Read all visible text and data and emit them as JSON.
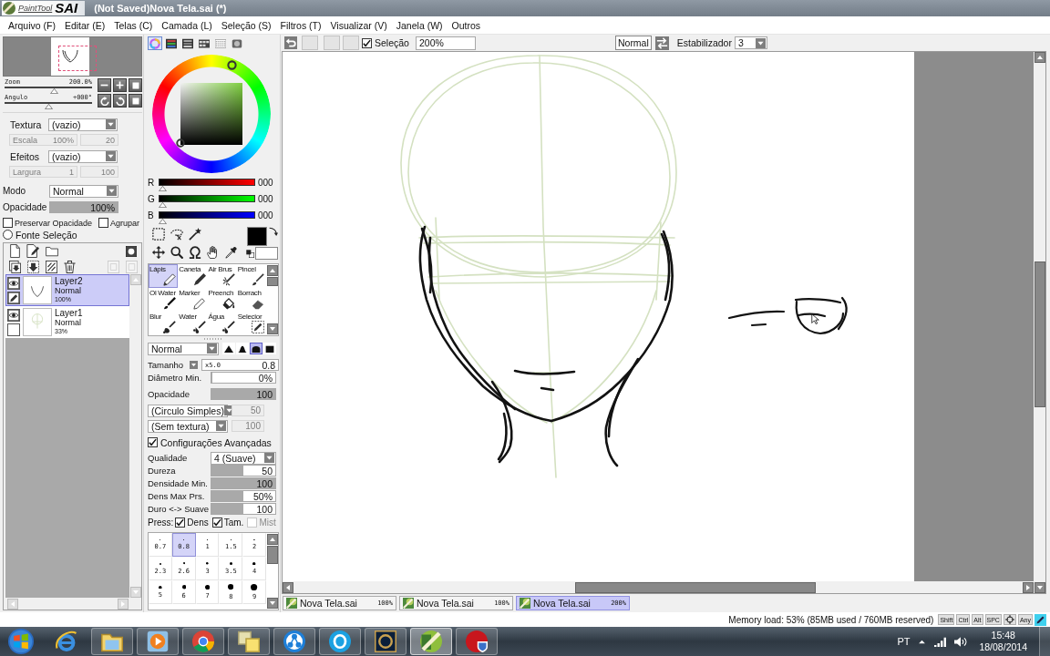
{
  "title_bar": {
    "logo_small": "PaintTool",
    "logo_large": "SAI",
    "title": "(Not Saved)Nova Tela.sai (*)"
  },
  "menu": [
    {
      "label": "Arquivo (F)"
    },
    {
      "label": "Editar (E)"
    },
    {
      "label": "Telas (C)"
    },
    {
      "label": "Camada (L)"
    },
    {
      "label": "Seleção (S)"
    },
    {
      "label": "Filtros (T)"
    },
    {
      "label": "Visualizar (V)"
    },
    {
      "label": "Janela (W)"
    },
    {
      "label": "Outros"
    }
  ],
  "navigator": {
    "zoom": {
      "label": "Zoom",
      "value": "200.0%",
      "level": 0.58
    },
    "angle": {
      "label": "Angulo",
      "value": "+000°",
      "level": 0.5
    }
  },
  "texture": {
    "label": "Textura",
    "value": "(vazio)",
    "sub_label": "Escala",
    "sub_value": "100%",
    "sub_value_2": "20",
    "disabled": true
  },
  "effects": {
    "label": "Efeitos",
    "value": "(vazio)",
    "sub_label": "Largura",
    "sub_value": "1",
    "sub_value_2": "100",
    "disabled": true
  },
  "layer_settings": {
    "mode_label": "Modo",
    "mode": "Normal",
    "opacity": {
      "label": "Opacidade",
      "value": "100%",
      "level": 1
    },
    "options": [
      {
        "label": "Preservar Opacidade",
        "checked": false
      },
      {
        "label": "Agrupar",
        "checked": false
      }
    ],
    "selection_source": {
      "label": "Fonte Seleção",
      "selected": false
    }
  },
  "layers": [
    {
      "name": "Layer2",
      "mode": "Normal",
      "opacity": "100%",
      "kind": "ink",
      "selected": true,
      "visible": true,
      "editing": true
    },
    {
      "name": "Layer1",
      "mode": "Normal",
      "opacity": "33%",
      "kind": "guide",
      "selected": false,
      "visible": true,
      "editing": false
    }
  ],
  "color_panel": {
    "tabs": [
      {
        "kind": "wheel",
        "selected": true
      },
      {
        "kind": "rgb",
        "selected": false
      },
      {
        "kind": "hsv",
        "selected": false
      },
      {
        "kind": "swatches",
        "selected": false
      },
      {
        "kind": "grid",
        "selected": false
      },
      {
        "kind": "scratch",
        "selected": false
      }
    ],
    "channels": [
      {
        "label": "R",
        "value": "000",
        "level": 0,
        "kind": "red"
      },
      {
        "label": "G",
        "value": "000",
        "level": 0,
        "kind": "green"
      },
      {
        "label": "B",
        "value": "000",
        "level": 0,
        "kind": "blue"
      }
    ],
    "colors": [
      {
        "kind": "primary",
        "color": "#000000"
      },
      {
        "kind": "secondary",
        "color": "#ffffff"
      }
    ]
  },
  "selection_tools": [
    {
      "tools": [
        {
          "kind": "marquee",
          "selected": false
        },
        {
          "kind": "lasso",
          "selected": false
        },
        {
          "kind": "wand",
          "selected": false
        }
      ]
    },
    {
      "tools": [
        {
          "kind": "move",
          "selected": false
        },
        {
          "kind": "zoom",
          "selected": false
        },
        {
          "kind": "rotate",
          "selected": false
        },
        {
          "kind": "hand",
          "selected": false
        },
        {
          "kind": "picker",
          "selected": false
        }
      ]
    }
  ],
  "brush_tools": [
    {
      "label": "Lápis",
      "kind": "pencil",
      "selected": true
    },
    {
      "label": "Caneta",
      "kind": "pen",
      "selected": false
    },
    {
      "label": "Air Brus",
      "kind": "airbrush",
      "selected": false
    },
    {
      "label": "Pincel",
      "kind": "brush",
      "selected": false
    },
    {
      "label": "Ol Water",
      "kind": "watercolor",
      "selected": false
    },
    {
      "label": "Marker",
      "kind": "marker",
      "selected": false
    },
    {
      "label": "Preench",
      "kind": "bucket",
      "selected": false
    },
    {
      "label": "Borrach",
      "kind": "eraser",
      "selected": false
    },
    {
      "label": "Blur",
      "kind": "blur",
      "selected": false
    },
    {
      "label": "Water",
      "kind": "water",
      "selected": false
    },
    {
      "label": "Água",
      "kind": "water",
      "selected": false
    },
    {
      "label": "Selecior",
      "kind": "selpen",
      "selected": false
    }
  ],
  "brush_settings": {
    "blend": "Normal",
    "shapes": [
      {
        "kind": "peak",
        "selected": false
      },
      {
        "kind": "bell",
        "selected": false
      },
      {
        "kind": "dome",
        "selected": true
      },
      {
        "kind": "flat",
        "selected": false
      }
    ],
    "size": {
      "label": "Tamanho",
      "multiplier": "x5.0",
      "value": "0.8"
    },
    "min_size": {
      "label": "Diâmetro Min.",
      "value": "0%",
      "level": 0
    },
    "opacity": {
      "label": "Opacidade",
      "value": "100",
      "level": 1
    },
    "shape": {
      "value": "(Circulo Simples)",
      "amount": "50",
      "disabled": true
    },
    "paper": {
      "value": "(Sem textura)",
      "amount": "100",
      "disabled": true
    },
    "advanced": {
      "label": "Configurações Avançadas",
      "checked": true
    },
    "quality": {
      "label": "Qualidade",
      "value": "4 (Suave)"
    },
    "sliders": [
      {
        "label": "Dureza",
        "value": "50",
        "level": 0.5
      },
      {
        "label": "Densidade Min.",
        "value": "100",
        "level": 1
      },
      {
        "label": "Dens Max Prs.",
        "value": "50%",
        "level": 0.5
      },
      {
        "label": "Duro <-> Suave",
        "value": "100",
        "level": 0.5
      }
    ],
    "pressure": {
      "label": "Press:",
      "options": [
        {
          "label": "Dens",
          "checked": true,
          "disabled": false
        },
        {
          "label": "Tam.",
          "checked": true,
          "disabled": false
        },
        {
          "label": "Mist",
          "checked": false,
          "disabled": true
        }
      ]
    },
    "sizes": [
      {
        "label": "0.7",
        "selected": false
      },
      {
        "label": "0.8",
        "selected": true
      },
      {
        "label": "1",
        "selected": false
      },
      {
        "label": "1.5",
        "selected": false
      },
      {
        "label": "2",
        "selected": false
      },
      {
        "label": "2.3",
        "selected": false
      },
      {
        "label": "2.6",
        "selected": false
      },
      {
        "label": "3",
        "selected": false
      },
      {
        "label": "3.5",
        "selected": false
      },
      {
        "label": "4",
        "selected": false
      },
      {
        "label": "5",
        "selected": false
      },
      {
        "label": "6",
        "selected": false
      },
      {
        "label": "7",
        "selected": false
      },
      {
        "label": "8",
        "selected": false
      },
      {
        "label": "9",
        "selected": false
      }
    ]
  },
  "canvas_toolbar": {
    "selection": {
      "label": "Seleção",
      "checked": true
    },
    "zoom": "200%",
    "quality": "Normal",
    "stabilizer": {
      "label": "Estabilizador",
      "value": "3"
    }
  },
  "documents": [
    {
      "name": "Nova Tela.sai",
      "zoom": "100%",
      "selected": false
    },
    {
      "name": "Nova Tela.sai",
      "zoom": "100%",
      "selected": false
    },
    {
      "name": "Nova Tela.sai",
      "zoom": "200%",
      "selected": true
    }
  ],
  "status_bar": {
    "memory": "Memory load: 53% (85MB used / 760MB reserved)",
    "keys": [
      {
        "kind": "text",
        "label": "Shift"
      },
      {
        "kind": "text",
        "label": "Ctrl"
      },
      {
        "kind": "text",
        "label": "Alt"
      },
      {
        "kind": "text",
        "label": "SPC"
      },
      {
        "kind": "icon"
      },
      {
        "kind": "text",
        "label": "Any"
      }
    ]
  },
  "taskbar": {
    "apps": [
      {
        "kind": "ie",
        "running": false,
        "active": false
      },
      {
        "kind": "explorer",
        "running": true,
        "active": false
      },
      {
        "kind": "media",
        "running": true,
        "active": false
      },
      {
        "kind": "chrome",
        "running": true,
        "active": false
      },
      {
        "kind": "notes",
        "running": true,
        "active": false
      },
      {
        "kind": "orbs",
        "running": true,
        "active": false
      },
      {
        "kind": "skype",
        "running": true,
        "active": false
      },
      {
        "kind": "league",
        "running": true,
        "active": false
      },
      {
        "kind": "sai",
        "running": true,
        "active": true
      },
      {
        "kind": "recorder",
        "running": true,
        "active": false
      }
    ],
    "language": "PT",
    "time": "15:48",
    "date": "18/08/2014"
  }
}
